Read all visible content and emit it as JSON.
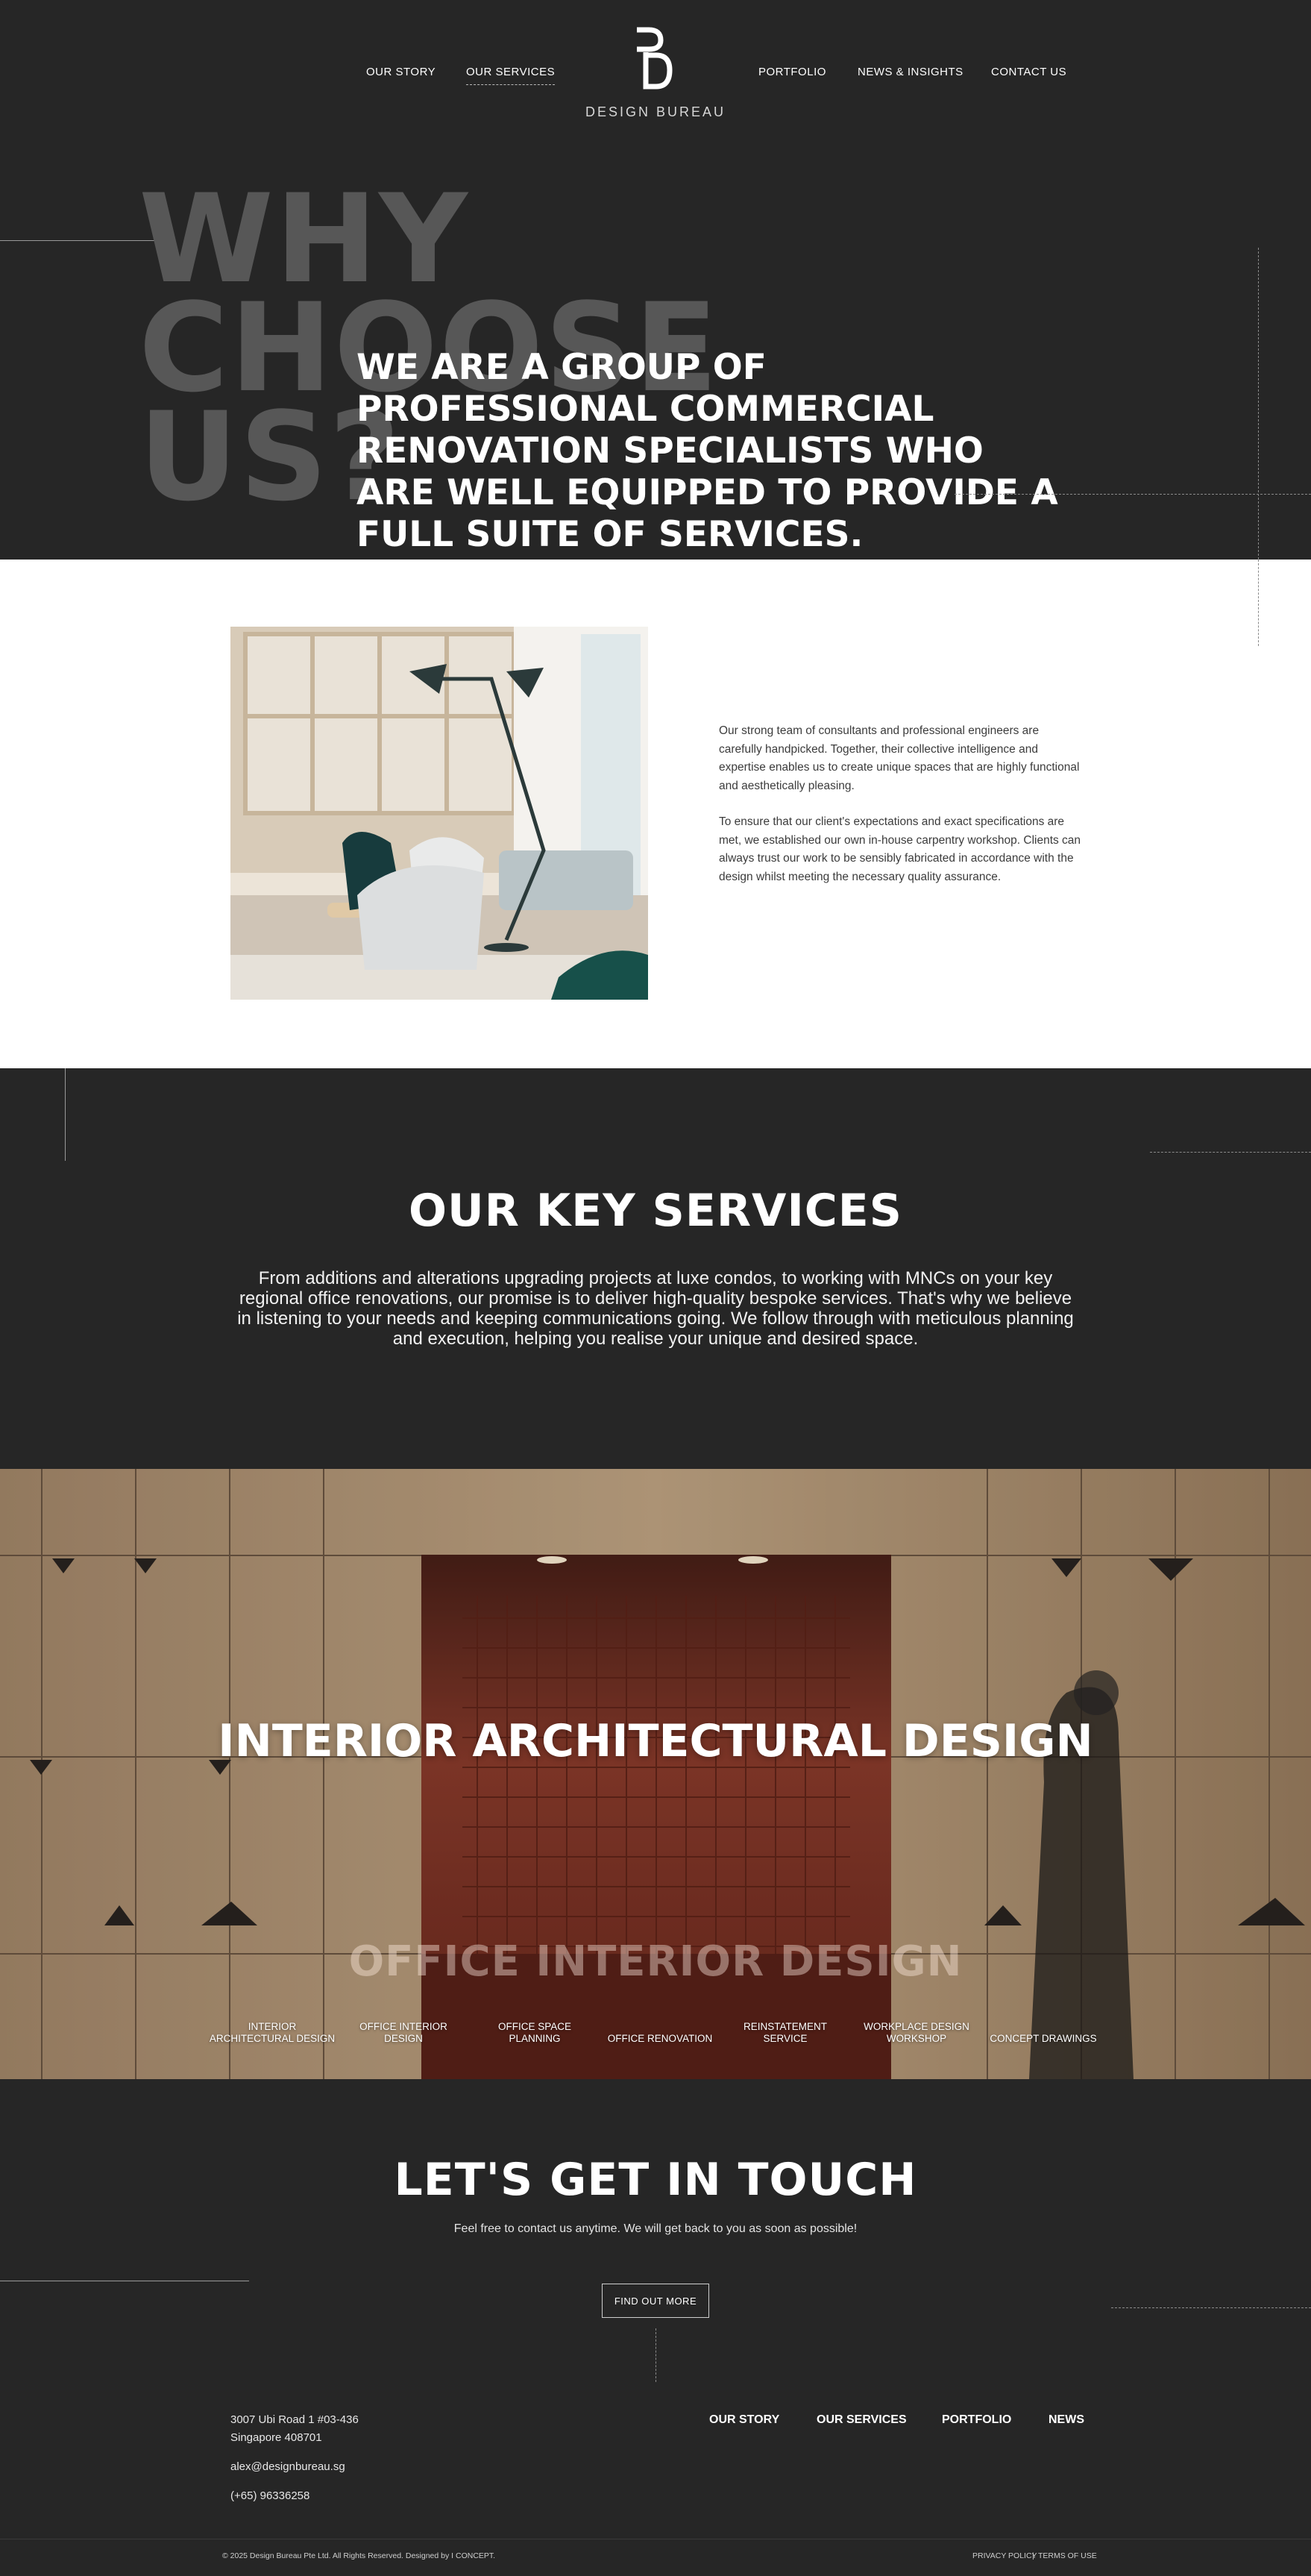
{
  "header": {
    "nav_left": [
      "OUR STORY",
      "OUR SERVICES"
    ],
    "nav_right": [
      "PORTFOLIO",
      "NEWS & INSIGHTS",
      "CONTACT US"
    ],
    "brand": "DESIGN BUREAU"
  },
  "hero": {
    "big_lines": [
      "WHY",
      "CHOOSE",
      "US?"
    ],
    "statement": "WE ARE A GROUP OF PROFESSIONAL COMMERCIAL RENOVATION SPECIALISTS WHO ARE WELL EQUIPPED TO PROVIDE A FULL SUITE OF SERVICES."
  },
  "about": {
    "paragraph_1": "Our strong team of consultants and professional engineers are carefully handpicked. Together, their collective intelligence and expertise enables us to create unique spaces that are highly functional and aesthetically pleasing.",
    "paragraph_2": "To ensure that our client's expectations and exact specifications are met, we established our own in-house carpentry workshop. Clients can always trust our work to be sensibly fabricated in accordance with the design whilst meeting the necessary quality assurance."
  },
  "services": {
    "title": "OUR KEY SERVICES",
    "description": "From additions and alterations upgrading projects at luxe condos, to working with MNCs on your key regional office renovations, our promise is to deliver high-quality bespoke services. That's why we believe in listening to your needs and keeping communications going. We follow through with meticulous planning and execution, helping you realise your unique and desired space."
  },
  "banner": {
    "title": "INTERIOR ARCHITECTURAL DESIGN",
    "ghost_title": "OFFICE INTERIOR DESIGN",
    "tabs": [
      "INTERIOR ARCHITECTURAL DESIGN",
      "OFFICE INTERIOR DESIGN",
      "OFFICE SPACE PLANNING",
      "OFFICE RENOVATION",
      "REINSTATEMENT SERVICE",
      "WORKPLACE DESIGN WORKSHOP",
      "CONCEPT DRAWINGS"
    ]
  },
  "contact": {
    "title": "LET'S GET IN TOUCH",
    "subtitle": "Feel free to contact us anytime. We will get back to you as soon as possible!",
    "button": "FIND OUT MORE"
  },
  "footer": {
    "address_line1": "3007 Ubi Road 1 #03-436",
    "address_line2": "Singapore 408701",
    "email": "alex@designbureau.sg",
    "phone": "(+65) 96336258",
    "links": [
      "OUR STORY",
      "OUR SERVICES",
      "PORTFOLIO",
      "NEWS"
    ],
    "copyright": "© 2025 Design Bureau Pte Ltd. All Rights Reserved. Designed by I CONCEPT.",
    "privacy": "PRIVACY POLICY",
    "separator": "|",
    "terms": "TERMS OF USE"
  },
  "colors": {
    "background_dark": "#262626",
    "ghost_text": "#575757",
    "white": "#ffffff"
  }
}
